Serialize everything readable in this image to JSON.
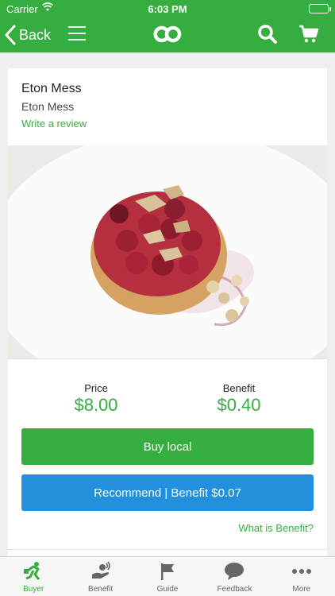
{
  "status_bar": {
    "carrier": "Carrier",
    "time": "6:03 PM"
  },
  "nav": {
    "back_label": "Back"
  },
  "product": {
    "title": "Eton Mess",
    "subtitle": "Eton Mess",
    "review_link": "Write a review",
    "price_label": "Price",
    "price_value": "$8.00",
    "benefit_label": "Benefit",
    "benefit_value": "$0.40"
  },
  "actions": {
    "buy_label": "Buy local",
    "recommend_label": "Recommend | Benefit $0.07",
    "what_is_benefit": "What is Benefit?"
  },
  "tabs": [
    {
      "label": "Buyer",
      "icon": "buyer-icon",
      "active": true
    },
    {
      "label": "Benefit",
      "icon": "benefit-icon",
      "active": false
    },
    {
      "label": "Guide",
      "icon": "flag-icon",
      "active": false
    },
    {
      "label": "Feedback",
      "icon": "speech-bubble-icon",
      "active": false
    },
    {
      "label": "More",
      "icon": "ellipsis-icon",
      "active": false
    }
  ],
  "colors": {
    "brand_green": "#36ae3f",
    "accent_blue": "#2290dc",
    "tab_inactive": "#666666"
  }
}
